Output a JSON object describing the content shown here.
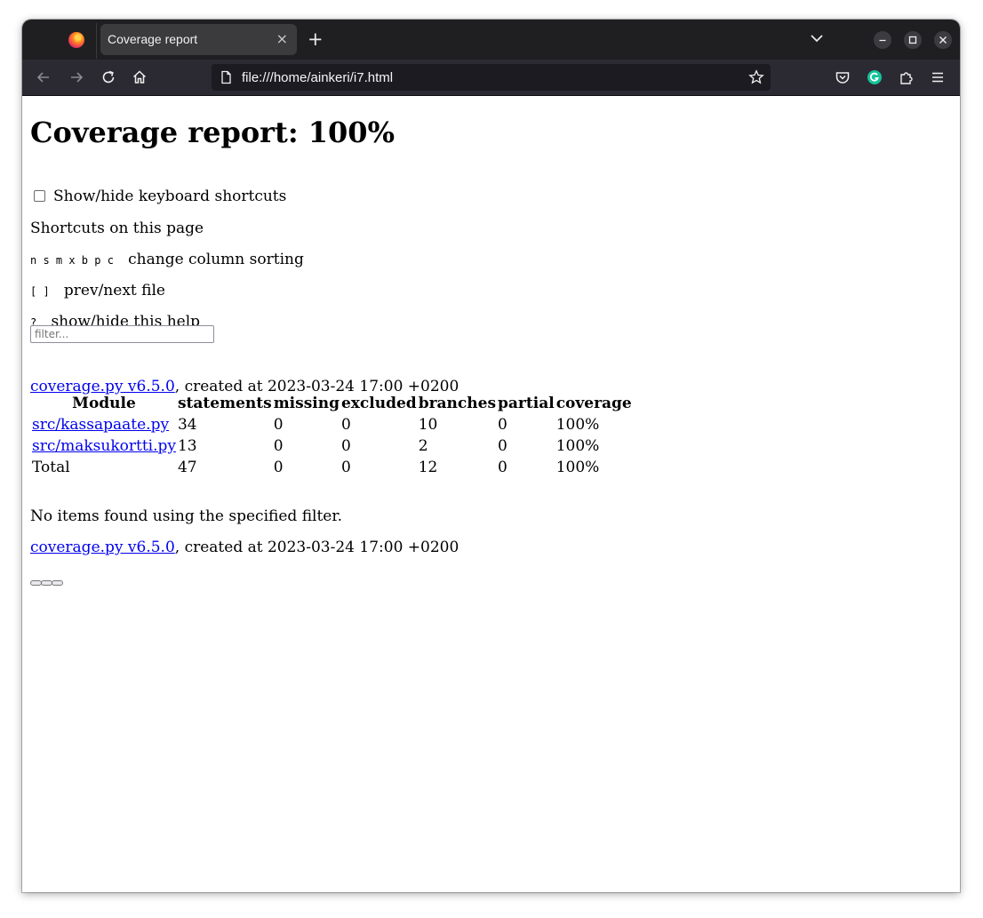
{
  "browser": {
    "tab_title": "Coverage report",
    "tab_close": "×",
    "new_tab": "+",
    "url": "file:///home/ainkeri/i7.html"
  },
  "page": {
    "title": "Coverage report: 100%",
    "keyboard_toggle_label": "Show/hide keyboard shortcuts",
    "shortcuts_heading": "Shortcuts on this page",
    "shortcuts": [
      {
        "keys": "n s m x b p c",
        "description": "change column sorting"
      },
      {
        "keys": "[ ]",
        "description": "prev/next file"
      },
      {
        "keys": "?",
        "description": "show/hide this help"
      }
    ],
    "filter_placeholder": "filter...",
    "footer_link": "coverage.py v6.5.0",
    "created_text": ", created at 2023-03-24 17:00 +0200",
    "table": {
      "headers": [
        "Module",
        "statements",
        "missing",
        "excluded",
        "branches",
        "partial",
        "coverage"
      ],
      "rows": [
        [
          "src/kassapaate.py",
          "34",
          "0",
          "0",
          "10",
          "0",
          "100%"
        ],
        [
          "src/maksukortti.py",
          "13",
          "0",
          "0",
          "2",
          "0",
          "100%"
        ],
        [
          "Total",
          "47",
          "0",
          "0",
          "12",
          "0",
          "100%"
        ]
      ]
    },
    "no_items": "No items found using the specified filter."
  }
}
